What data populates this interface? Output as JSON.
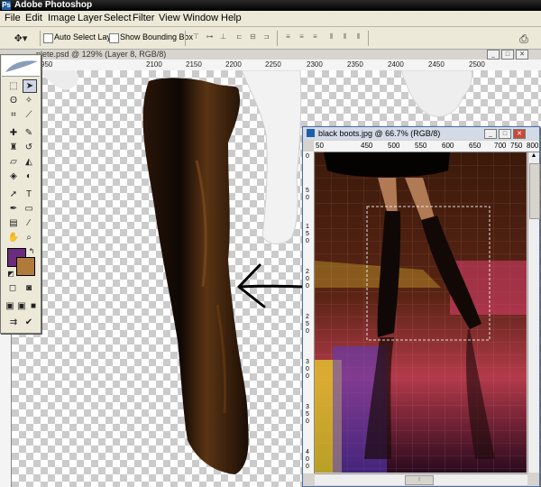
{
  "app": {
    "title": "Adobe Photoshop",
    "icon": "photoshop-icon"
  },
  "menu": [
    "File",
    "Edit",
    "Image",
    "Layer",
    "Select",
    "Filter",
    "View",
    "Window",
    "Help"
  ],
  "options_bar": {
    "auto_select_label": "Auto Select Layer",
    "auto_select_checked": false,
    "bounding_box_label": "Show Bounding Box",
    "bounding_box_checked": false
  },
  "documents": {
    "main": {
      "title": "plete.psd @ 129% (Layer 8, RGB/8)",
      "ruler_labels": [
        "950",
        "2100",
        "2150",
        "2200",
        "2250",
        "2300",
        "2350",
        "2400",
        "2450",
        "2500"
      ]
    },
    "secondary": {
      "title": "black boots.jpg @ 66.7% (RGB/8)",
      "ruler_labels": [
        "50",
        "450",
        "500",
        "550",
        "600",
        "650",
        "700",
        "750",
        "800"
      ],
      "vruler_labels": [
        "0",
        "5",
        "0",
        "1",
        "5",
        "0",
        "2",
        "0",
        "0",
        "2",
        "5",
        "0",
        "3",
        "0",
        "0",
        "3",
        "5",
        "0",
        "4",
        "0",
        "0"
      ]
    }
  },
  "toolbox": {
    "foreground_color": "#6b2c7e",
    "background_color": "#b07a3b"
  }
}
